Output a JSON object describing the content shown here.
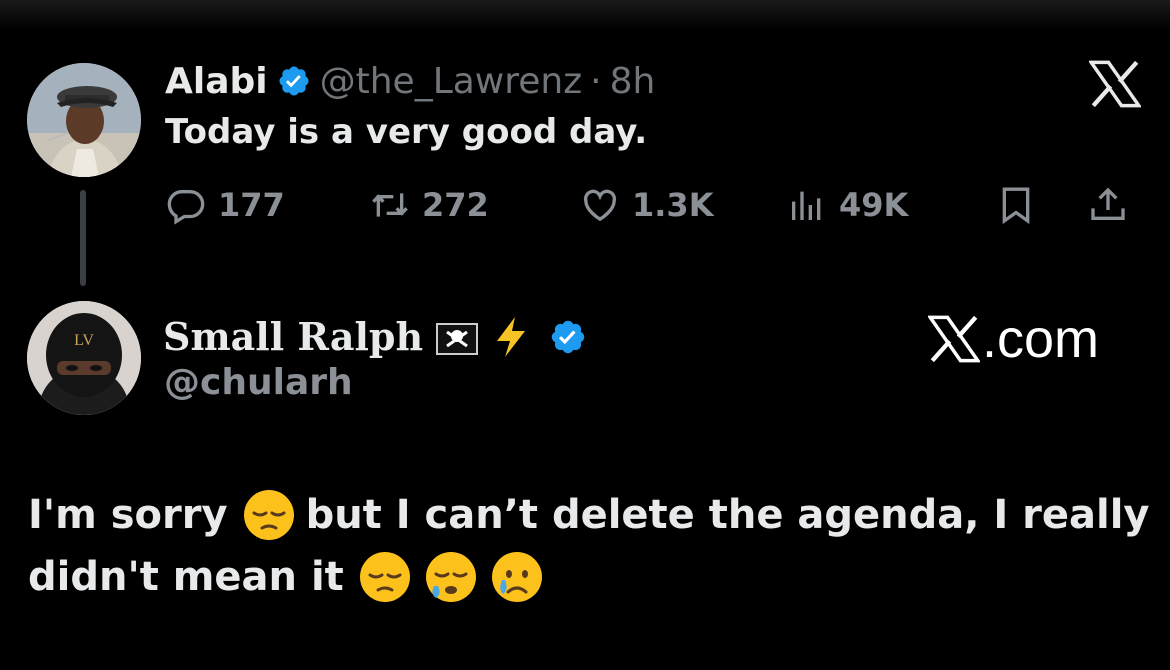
{
  "tweet1": {
    "name": "Alabi",
    "handle": "@the_Lawrenz",
    "separator": "·",
    "time": "8h",
    "text": "Today is a very good day.",
    "replies": "177",
    "reposts": "272",
    "likes": "1.3K",
    "views": "49K"
  },
  "tweet2": {
    "name": "Small Ralph",
    "handle": "@chularh",
    "line1_a": "I'm sorry",
    "line1_b": "but I can’t delete the agenda, I really",
    "line2": "didn't mean it"
  },
  "watermark": {
    "text": ".com"
  },
  "icons": {
    "reply": "reply-icon",
    "repost": "repost-icon",
    "like": "heart-icon",
    "views": "views-icon",
    "bookmark": "bookmark-icon",
    "share": "share-icon",
    "close": "x-logo-icon",
    "verified": "verified-badge-icon"
  },
  "colors": {
    "verified": "#1d9bf0",
    "muted": "#71767b",
    "text": "#e7e9ea",
    "background": "#000000"
  }
}
